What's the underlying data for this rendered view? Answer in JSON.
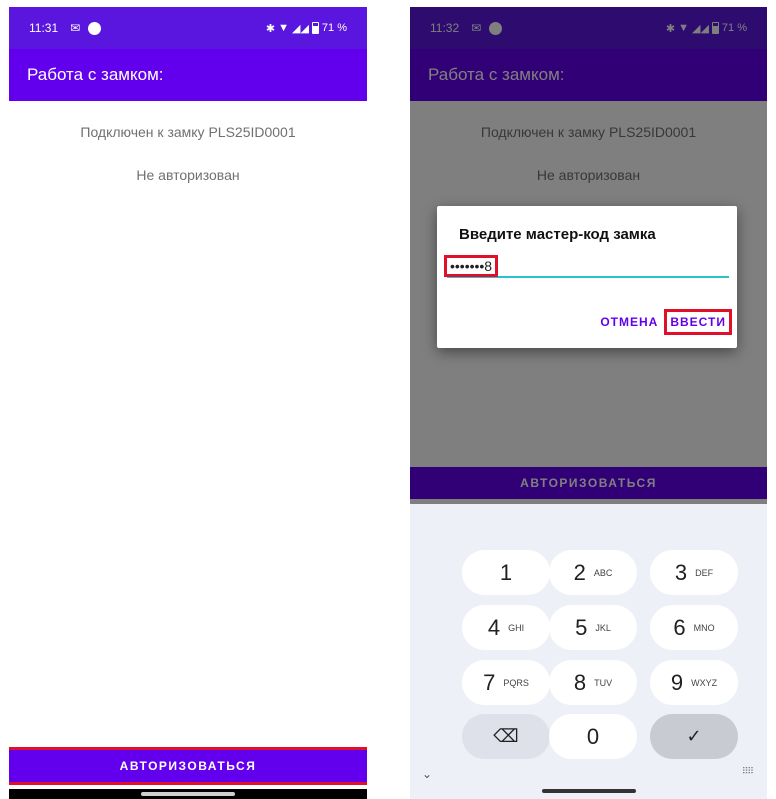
{
  "left_screen": {
    "status_bar": {
      "time": "11:31",
      "mail_icon": "gmail-icon",
      "battery": "71 %"
    },
    "app_bar": {
      "title": "Работа с замком:"
    },
    "connected_text": "Подключен к замку PLS25ID0001",
    "auth_status": "Не авторизован",
    "auth_button": "АВТОРИЗОВАТЬСЯ"
  },
  "right_screen": {
    "status_bar": {
      "time": "11:32",
      "mail_icon": "gmail-icon",
      "battery": "71 %"
    },
    "app_bar": {
      "title": "Работа с замком:"
    },
    "connected_text": "Подключен к замку PLS25ID0001",
    "auth_status": "Не авторизован",
    "auth_button": "АВТОРИЗОВАТЬСЯ",
    "dialog": {
      "title": "Введите мастер-код замка",
      "input_value": "•••••••8",
      "cancel_label": "ОТМЕНА",
      "confirm_label": "ВВЕСТИ"
    },
    "keyboard": {
      "keys": [
        {
          "num": "1",
          "letters": ""
        },
        {
          "num": "2",
          "letters": "ABC"
        },
        {
          "num": "3",
          "letters": "DEF"
        },
        {
          "num": "4",
          "letters": "GHI"
        },
        {
          "num": "5",
          "letters": "JKL"
        },
        {
          "num": "6",
          "letters": "MNO"
        },
        {
          "num": "7",
          "letters": "PQRS"
        },
        {
          "num": "8",
          "letters": "TUV"
        },
        {
          "num": "9",
          "letters": "WXYZ"
        }
      ],
      "zero": "0",
      "backspace_icon": "⌫",
      "done_icon": "✓"
    }
  },
  "colors": {
    "primary": "#6200ee",
    "status_bar": "#5a16de",
    "highlight": "#e0102a",
    "field_underline": "#26c6c6"
  }
}
